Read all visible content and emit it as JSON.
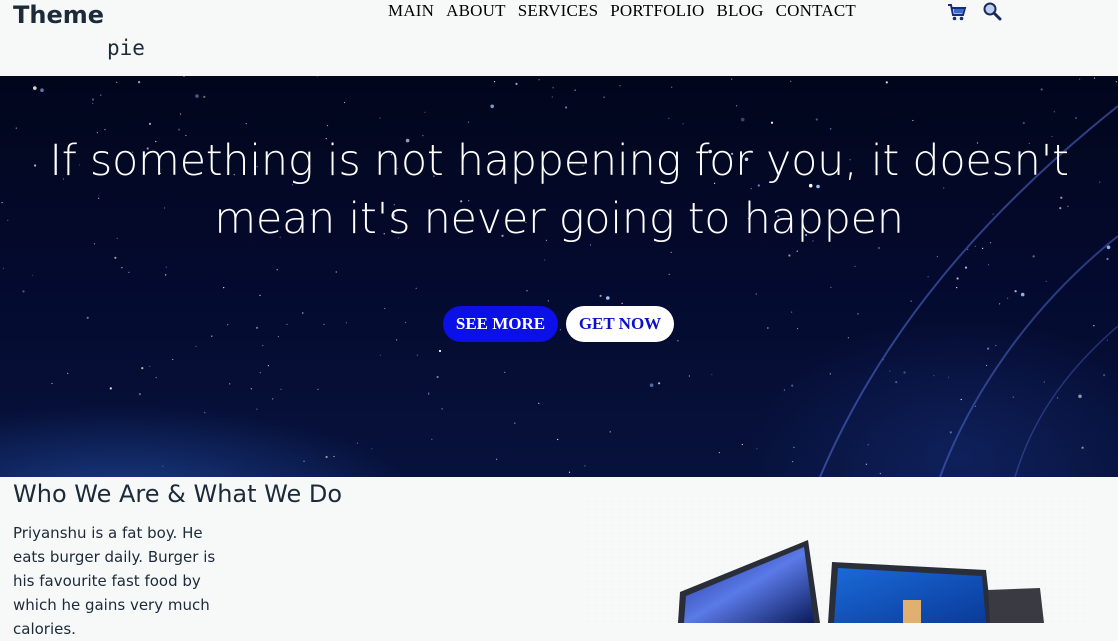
{
  "logo": {
    "line1": "Theme",
    "line2": "pie"
  },
  "nav": {
    "items": [
      "MAIN",
      "ABOUT",
      "SERVICES",
      "PORTFOLIO",
      "BLOG",
      "CONTACT"
    ]
  },
  "header_icons": {
    "cart": "cart-icon",
    "search": "search-icon"
  },
  "hero": {
    "headline_line1": "If something is not happening for you, it doesn't",
    "headline_line2": "mean it's never going to happen",
    "primary_button": "SEE MORE",
    "secondary_button": "GET NOW"
  },
  "about": {
    "title": "Who We Are & What We Do",
    "body": "Priyanshu is a fat boy. He eats burger daily. Burger is his favourite fast food by which he gains very much calories."
  },
  "colors": {
    "primary_button_bg": "#0b0fe8",
    "hero_bg": "#040a2e",
    "text": "#1c2a3a"
  }
}
